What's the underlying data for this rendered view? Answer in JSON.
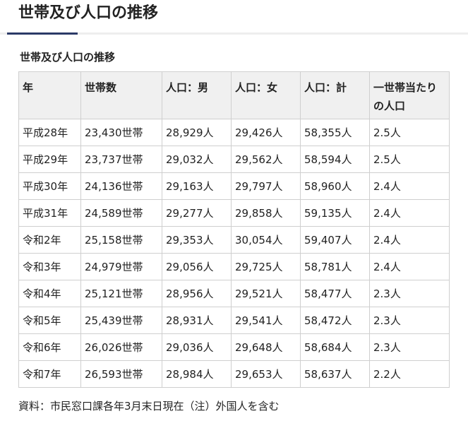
{
  "page": {
    "title": "世帯及び人口の推移",
    "caption": "世帯及び人口の推移",
    "footnote": "資料：市民窓口課各年3月末日現在（注）外国人を含む"
  },
  "table": {
    "headers": [
      "年",
      "世帯数",
      "人口：男",
      "人口：女",
      "人口：計",
      "一世帯当たりの人口"
    ],
    "rows": [
      [
        "平成28年",
        "23,430世帯",
        "28,929人",
        "29,426人",
        "58,355人",
        "2.5人"
      ],
      [
        "平成29年",
        "23,737世帯",
        "29,032人",
        "29,562人",
        "58,594人",
        "2.5人"
      ],
      [
        "平成30年",
        "24,136世帯",
        "29,163人",
        "29,797人",
        "58,960人",
        "2.4人"
      ],
      [
        "平成31年",
        "24,589世帯",
        "29,277人",
        "29,858人",
        "59,135人",
        "2.4人"
      ],
      [
        "令和2年",
        "25,158世帯",
        "29,353人",
        "30,054人",
        "59,407人",
        "2.4人"
      ],
      [
        "令和3年",
        "24,979世帯",
        "29,056人",
        "29,725人",
        "58,781人",
        "2.4人"
      ],
      [
        "令和4年",
        "25,121世帯",
        "28,956人",
        "29,521人",
        "58,477人",
        "2.3人"
      ],
      [
        "令和5年",
        "25,439世帯",
        "28,931人",
        "29,541人",
        "58,472人",
        "2.3人"
      ],
      [
        "令和6年",
        "26,026世帯",
        "29,036人",
        "29,648人",
        "58,684人",
        "2.3人"
      ],
      [
        "令和7年",
        "26,593世帯",
        "28,984人",
        "29,653人",
        "58,637人",
        "2.2人"
      ]
    ]
  },
  "colors": {
    "accent": "#2b3a67",
    "header_bg": "#f0f0f0",
    "border": "#cfcfcf"
  }
}
